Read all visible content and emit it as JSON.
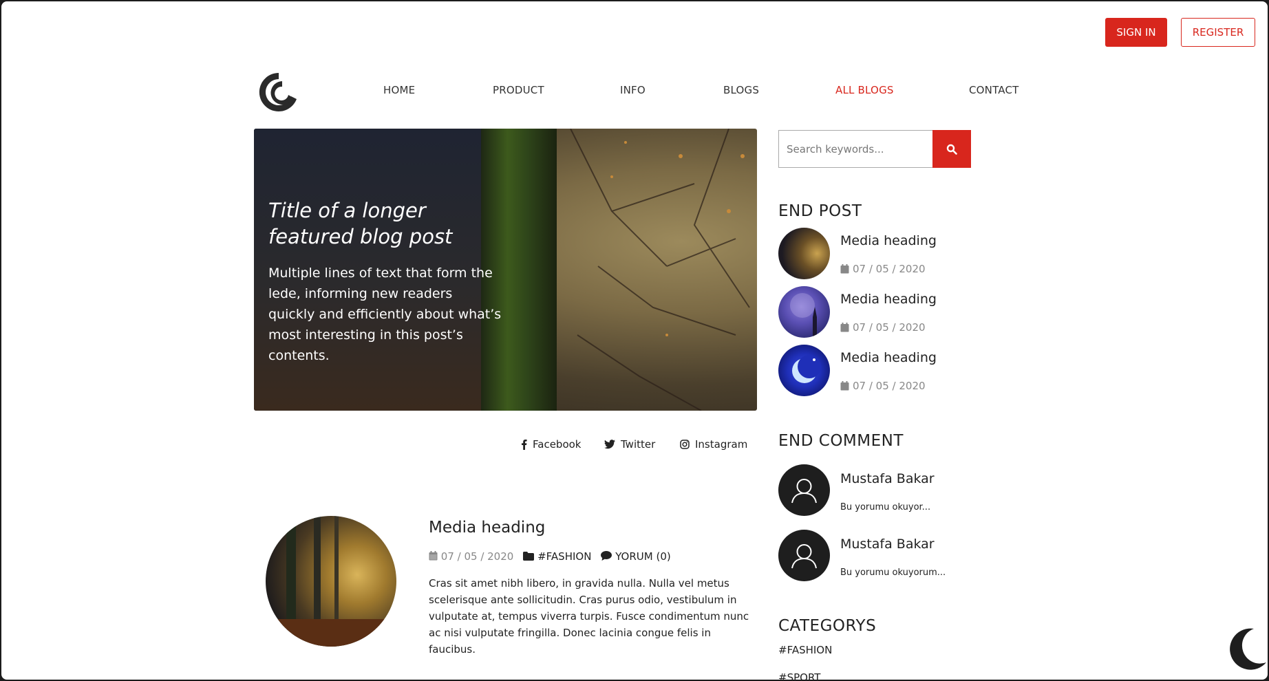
{
  "auth": {
    "signin_label": "SIGN IN",
    "register_label": "REGISTER"
  },
  "nav": {
    "items": [
      {
        "label": "HOME"
      },
      {
        "label": "PRODUCT"
      },
      {
        "label": "INFO"
      },
      {
        "label": "BLOGS"
      },
      {
        "label": "ALL BLOGS",
        "active": true
      },
      {
        "label": "CONTACT"
      }
    ]
  },
  "hero": {
    "title": "Title of a longer featured blog post",
    "lede": "Multiple lines of text that form the lede, informing new readers quickly and efficiently about what’s most interesting in this post’s contents."
  },
  "social": [
    {
      "label": "Facebook",
      "icon": "facebook-icon"
    },
    {
      "label": "Twitter",
      "icon": "twitter-icon"
    },
    {
      "label": "Instagram",
      "icon": "instagram-icon"
    }
  ],
  "post": {
    "title": "Media heading",
    "date": "07 / 05 / 2020",
    "tag": "#FASHION",
    "comments": "YORUM (0)",
    "body": "Cras sit amet nibh libero, in gravida nulla. Nulla vel metus scelerisque ante sollicitudin. Cras purus odio, vestibulum in vulputate at, tempus viverra turpis. Fusce condimentum nunc ac nisi vulputate fringilla. Donec lacinia congue felis in faucibus."
  },
  "search": {
    "placeholder": "Search keywords..."
  },
  "sidebar": {
    "end_post_title": "END POST",
    "end_posts": [
      {
        "title": "Media heading",
        "date": "07 / 05 / 2020"
      },
      {
        "title": "Media heading",
        "date": "07 / 05 / 2020"
      },
      {
        "title": "Media heading",
        "date": "07 / 05 / 2020"
      }
    ],
    "end_comment_title": "END COMMENT",
    "end_comments": [
      {
        "name": "Mustafa Bakar",
        "text": "Bu yorumu okuyor..."
      },
      {
        "name": "Mustafa Bakar",
        "text": "Bu yorumu okuyorum..."
      }
    ],
    "categories_title": "CATEGORYS",
    "categories": [
      "#FASHION",
      "#SPORT"
    ]
  },
  "colors": {
    "accent": "#d8261d"
  }
}
